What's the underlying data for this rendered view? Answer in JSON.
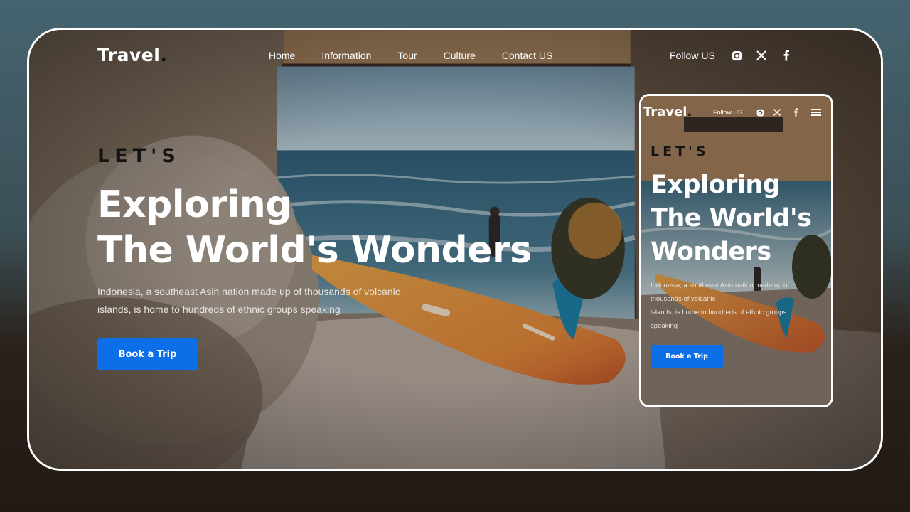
{
  "desktop": {
    "logo": {
      "text": "Travel",
      "dot": "."
    },
    "nav": [
      "Home",
      "Information",
      "Tour",
      "Culture",
      "Contact US"
    ],
    "follow_label": "Follow US",
    "social_icons": [
      "instagram-icon",
      "x-icon",
      "facebook-icon"
    ],
    "hero": {
      "eyebrow": "LET'S",
      "title_line1": "Exploring",
      "title_line2": "The World's Wonders",
      "description_line1": "Indonesia, a southeast Asin nation made up of thousands of volcanic",
      "description_line2": "islands, is home to hundreds of ethnic groups speaking",
      "cta": "Book a Trip"
    }
  },
  "mobile": {
    "logo": {
      "text": "Travel",
      "dot": "."
    },
    "follow_label": "Follow US",
    "social_icons": [
      "instagram-icon",
      "x-icon",
      "facebook-icon",
      "menu-icon"
    ],
    "hero": {
      "eyebrow": "LET'S",
      "title_line1": "Exploring",
      "title_line2": "The World's",
      "title_line3": "Wonders",
      "description_line1": "Indonesia, a southeast Asin nation made up of",
      "description_line2": "thousands of volcanic",
      "description_line3": "islands, is home to hundreds of ethnic groups",
      "description_line4": "speaking",
      "cta": "Book a Trip"
    }
  },
  "colors": {
    "accent": "#0d6fe8",
    "frame_border": "#ffffff",
    "background_top": "#456470",
    "background_bottom": "#221a15"
  }
}
